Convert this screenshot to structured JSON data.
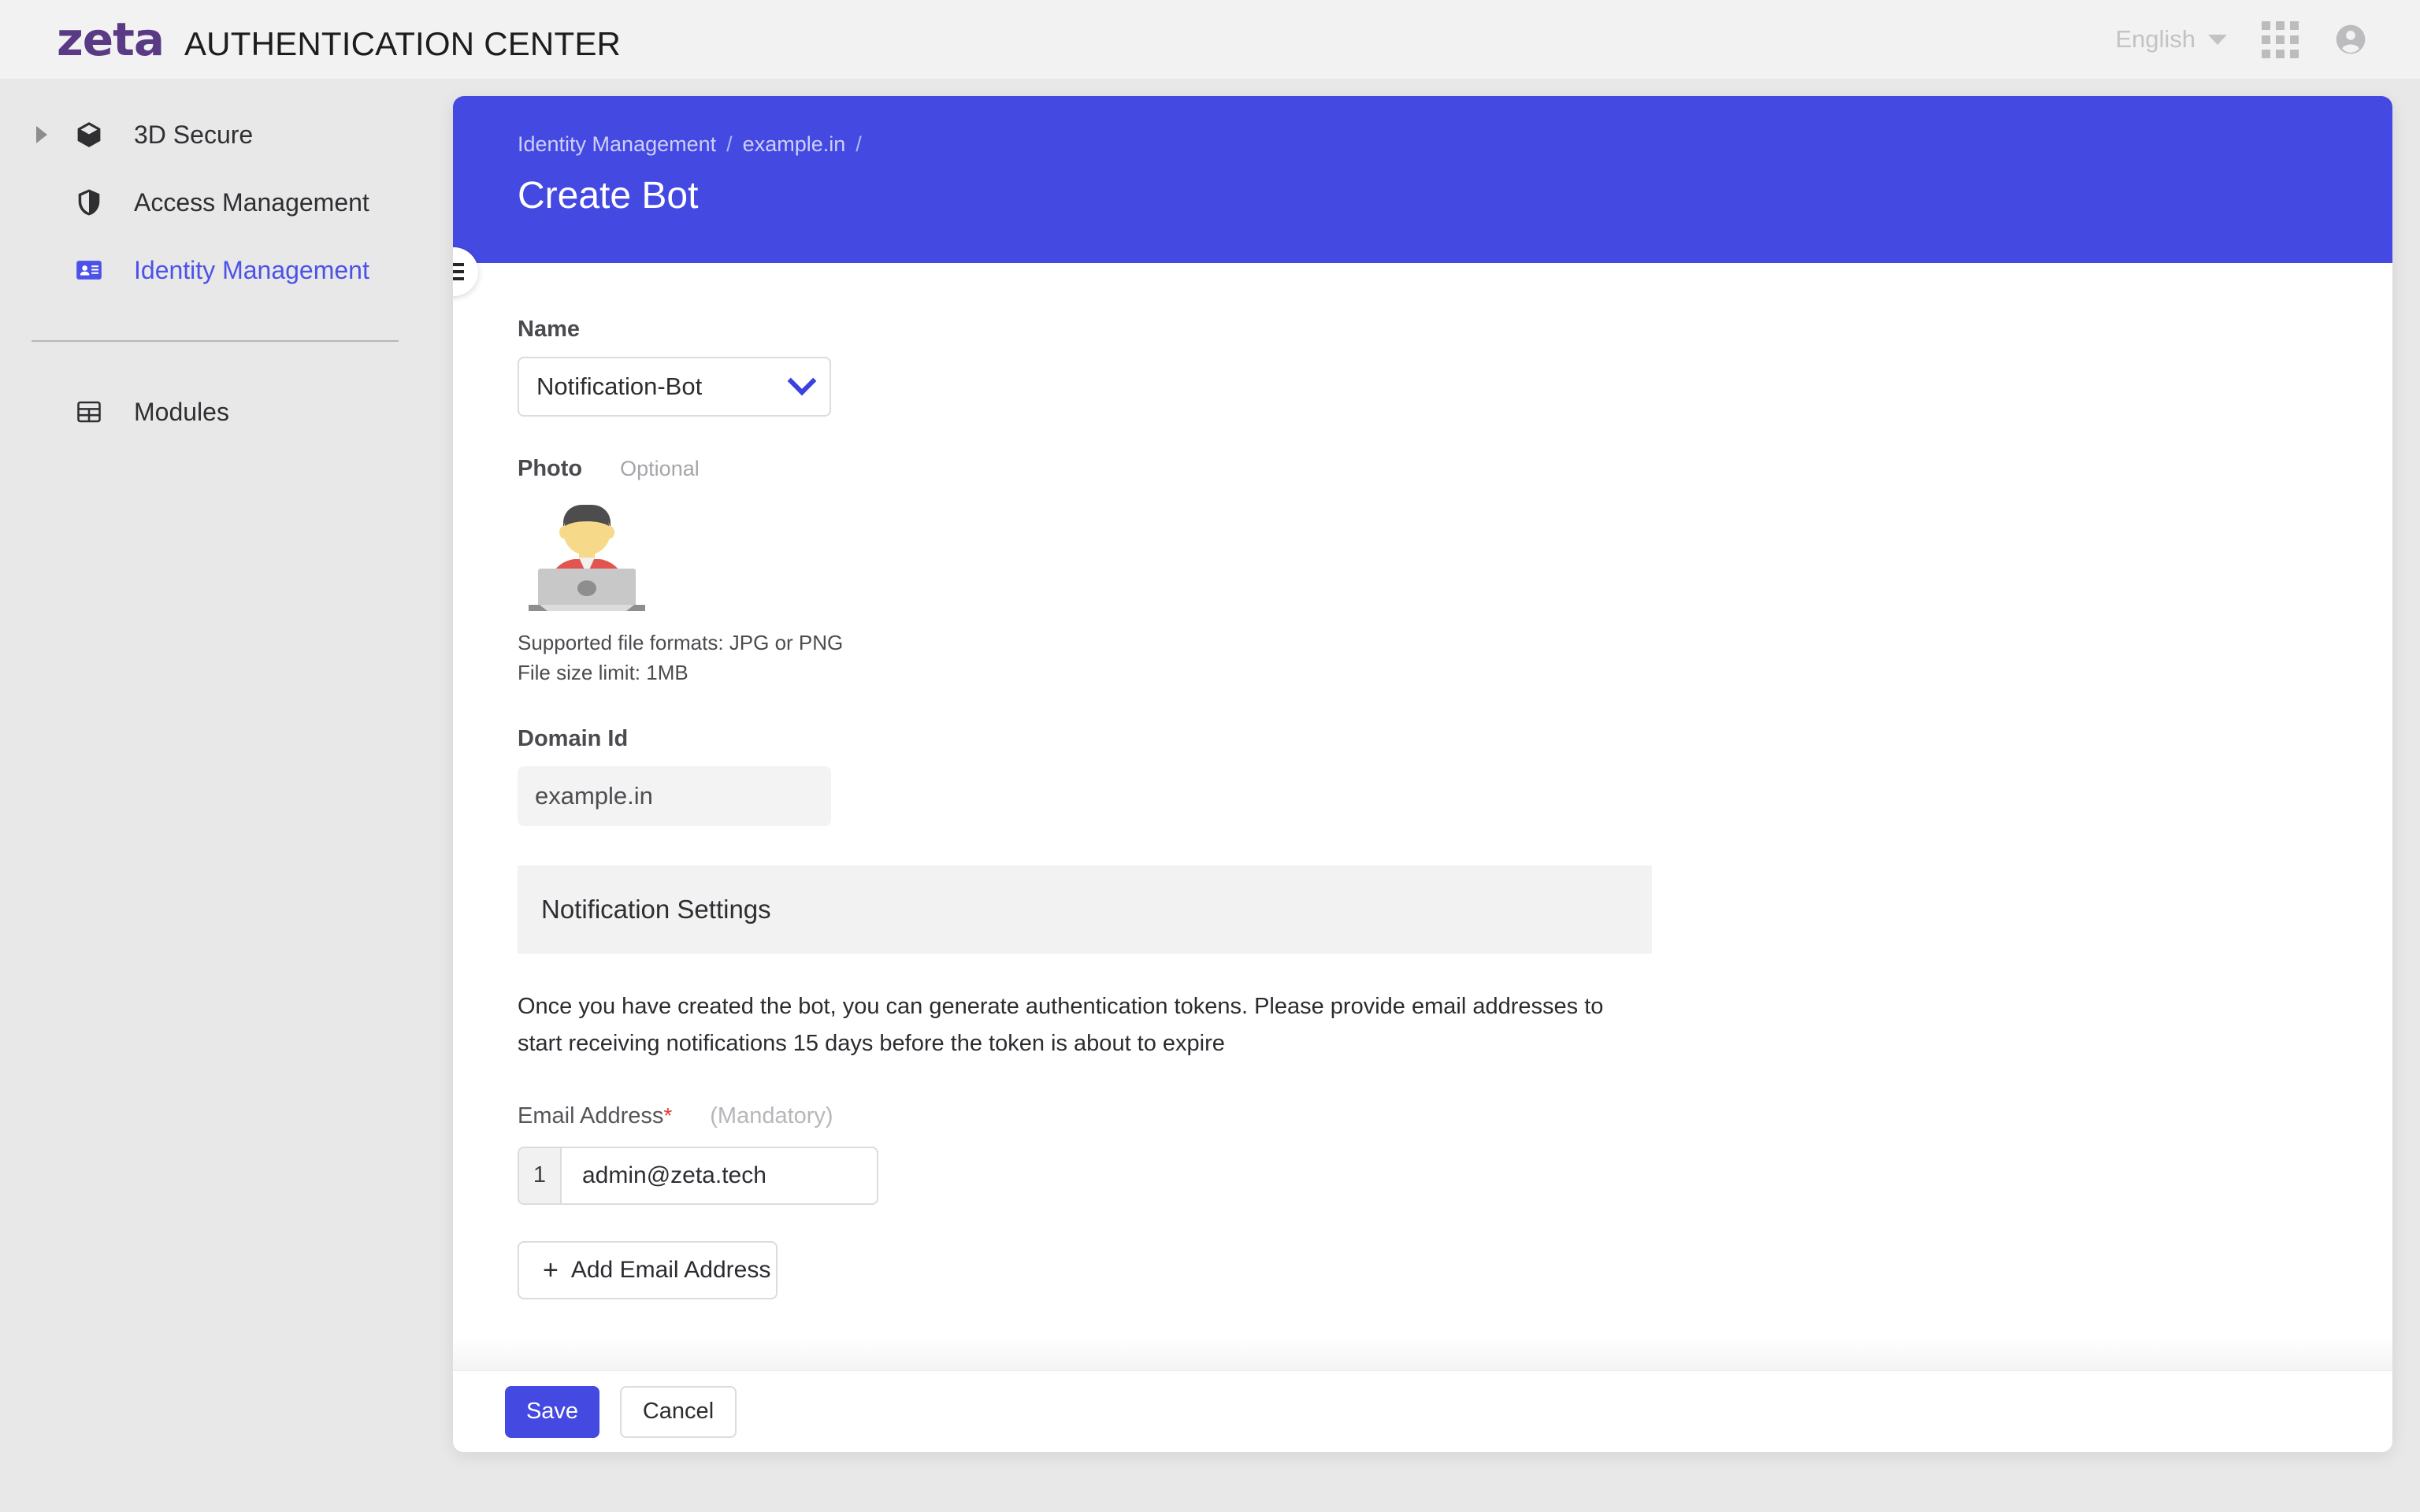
{
  "header": {
    "logo_text": "zeta",
    "app_title": "AUTHENTICATION CENTER",
    "language": "English",
    "apps_icon": "grid-apps-icon",
    "account_icon": "account-circle-icon"
  },
  "sidebar": {
    "items": [
      {
        "label": "3D Secure",
        "icon": "cube-3d-icon",
        "expandable": true,
        "active": false
      },
      {
        "label": "Access Management",
        "icon": "shield-icon",
        "expandable": false,
        "active": false
      },
      {
        "label": "Identity Management",
        "icon": "id-card-icon",
        "expandable": false,
        "active": true
      }
    ],
    "secondary_items": [
      {
        "label": "Modules",
        "icon": "table-grid-icon",
        "active": false
      }
    ],
    "toggle_icon": "hamburger-menu-icon"
  },
  "page": {
    "breadcrumb": [
      "Identity Management",
      "example.in",
      ""
    ],
    "breadcrumb_separator": "/",
    "title": "Create Bot",
    "accent_color": "#4449e2"
  },
  "form": {
    "name": {
      "label": "Name",
      "value": "Notification-Bot",
      "chevron_icon": "chevron-down-icon"
    },
    "photo": {
      "label": "Photo",
      "optional_text": "Optional",
      "alt": "bot-avatar-person-at-laptop",
      "note_line1": "Supported file formats: JPG or PNG",
      "note_line2": "File size limit: 1MB"
    },
    "domain": {
      "label": "Domain Id",
      "value": "example.in"
    },
    "notification": {
      "section_title": "Notification Settings",
      "description": "Once you have created the bot, you can generate authentication tokens. Please provide email addresses to start receiving notifications 15 days before the token is about to expire",
      "email_label": "Email Address",
      "required_marker": "*",
      "mandatory_text": "(Mandatory)",
      "emails": [
        {
          "index": "1",
          "value": "admin@zeta.tech"
        }
      ],
      "add_button": "Add Email Address",
      "add_icon": "plus-icon"
    }
  },
  "footer": {
    "save_label": "Save",
    "cancel_label": "Cancel"
  }
}
